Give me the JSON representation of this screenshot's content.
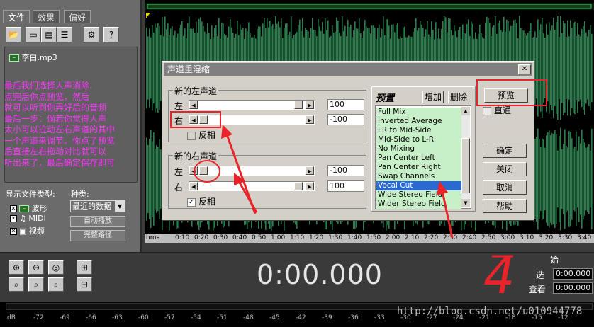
{
  "left_panel": {
    "tabs": [
      "文件",
      "效果",
      "偏好"
    ],
    "file_name": "李白.mp3",
    "annotation_text": "最后我们选择人声消除.\n点完后你点预览，然后\n就可以听到你弄好后的音频\n最后一步：倘若你觉得人声\n太小可以拉动左右声道的其中\n一个声道来调节。你点了预览\n后直接左右拖动对比就可以\n听出来了，最后确定保存即可",
    "file_types_label": "显示文件类型:",
    "kind_label": "种类:",
    "types": [
      {
        "label": "波形",
        "icon": "wave-file-icon"
      },
      {
        "label": "MIDI",
        "icon": "midi-note-icon"
      },
      {
        "label": "视频",
        "icon": "video-icon"
      }
    ],
    "kind_value": "最近的数据",
    "auto_play": "自动播放",
    "full_path": "完整路径"
  },
  "ruler": {
    "unit": "hms",
    "ticks": [
      "0:10",
      "0:20",
      "0:30",
      "0:40",
      "0:50",
      "1:00",
      "1:10",
      "1:20",
      "1:30",
      "1:40",
      "1:50",
      "2:00",
      "2:10",
      "2:20",
      "2:30",
      "2:40",
      "2:50",
      "3:00",
      "3:10",
      "3:20",
      "3:30",
      "3:40"
    ]
  },
  "dialog": {
    "title": "声道重混缩",
    "left_group": "新的左声道",
    "right_group": "新的右声道",
    "left_label": "左",
    "right_label": "右",
    "new_left": {
      "left_value": "100",
      "right_value": "-100",
      "left_level": 1.0,
      "right_level": 0.0,
      "invert_label": "反相",
      "invert_checked": false
    },
    "new_right": {
      "left_value": "-100",
      "right_value": "100",
      "left_level": 0.0,
      "right_level": 1.0,
      "invert_label": "反相",
      "invert_checked": true
    },
    "presets_title": "预置",
    "add_button": "增加",
    "delete_button": "删除",
    "presets": [
      "Full Mix",
      "Inverted Average",
      "LR to Mid-Side",
      "Mid-Side to L-R",
      "No Mixing",
      "Pan Center Left",
      "Pan Center Right",
      "Swap Channels",
      "Vocal Cut",
      "Wide Stereo Field",
      "Wider Stereo Field"
    ],
    "selected_preset": "Vocal Cut",
    "preview_button": "预览",
    "direct_label": "直通",
    "ok_button": "确定",
    "close_button": "关闭",
    "cancel_button": "取消",
    "help_button": "帮助"
  },
  "transport": {
    "time": "0:00.000",
    "begin_label": "始",
    "select_label": "选",
    "view_label": "查看",
    "select_value": "0:00.000",
    "view_value": "0:00.000"
  },
  "meter": {
    "scale": [
      "dB",
      "-72",
      "-69",
      "-66",
      "-63",
      "-60",
      "-57",
      "-54",
      "-51",
      "-48",
      "-45",
      "-42",
      "-39",
      "-36",
      "-33",
      "-30",
      "-27",
      "-24",
      "-21",
      "-18",
      "-15",
      "-12"
    ]
  },
  "watermark": "http://blog.csdn.net/u010944778",
  "handwritten": "4",
  "colors": {
    "annotation": "#ff33ff",
    "red_marks": "#e8242a",
    "wave": "#2e7d4f",
    "selection": "#2a6ad0"
  }
}
